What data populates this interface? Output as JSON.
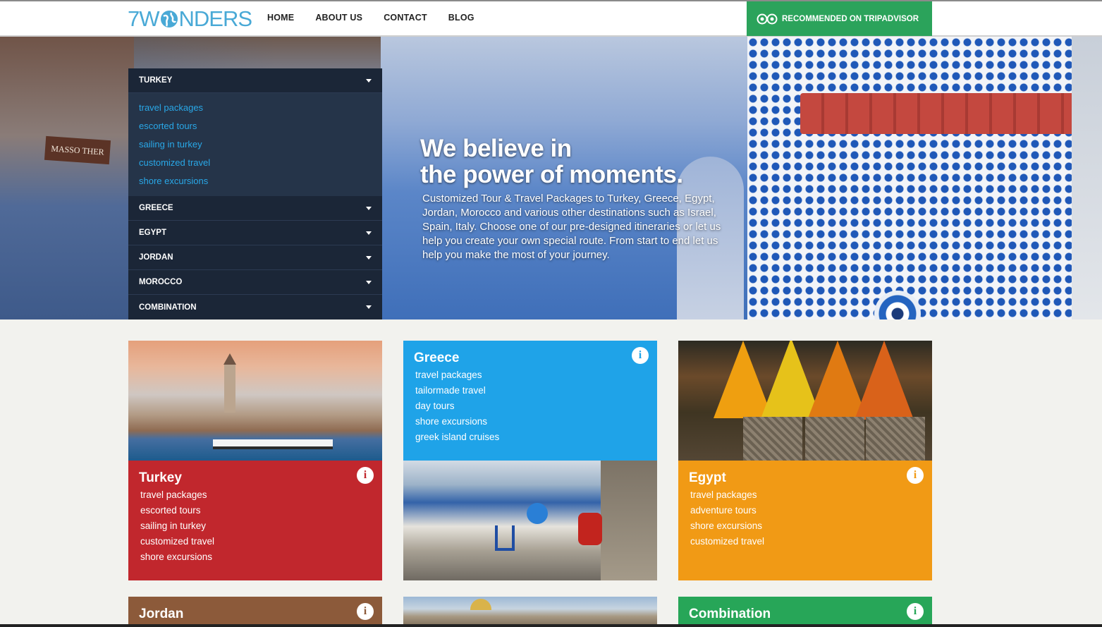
{
  "header": {
    "logo_text": "7WONDERS",
    "nav": [
      "HOME",
      "ABOUT US",
      "CONTACT",
      "BLOG"
    ],
    "tripadvisor_label": "RECOMMENDED ON TRIPADVISOR"
  },
  "hero": {
    "headline_line1": "We believe in",
    "headline_line2": "the power of moments.",
    "description": "Customized Tour & Travel Packages to Turkey, Greece, Egypt, Jordan, Morocco and various other destinations such as Israel, Spain, Italy. Choose one of our pre-designed itineraries or let us help you create your own special route. From start to end let us help you make the most of your journey.",
    "sign_text": "MASSO THER"
  },
  "sidemenu": {
    "items": [
      {
        "label": "TURKEY"
      },
      {
        "label": "GREECE"
      },
      {
        "label": "EGYPT"
      },
      {
        "label": "JORDAN"
      },
      {
        "label": "MOROCCO"
      },
      {
        "label": "COMBINATION"
      }
    ],
    "expanded_links": [
      "travel packages",
      "escorted tours",
      "sailing in turkey",
      "customized travel",
      "shore excursions"
    ]
  },
  "cards": {
    "turkey": {
      "title": "Turkey",
      "color": "#c1272d",
      "links": [
        "travel packages",
        "escorted tours",
        "sailing in turkey",
        "customized travel",
        "shore excursions"
      ]
    },
    "greece": {
      "title": "Greece",
      "color": "#1fa3e8",
      "links": [
        "travel packages",
        "tailormade travel",
        "day tours",
        "shore excursions",
        "greek island cruises"
      ]
    },
    "egypt": {
      "title": "Egypt",
      "color": "#f19a15",
      "links": [
        "travel packages",
        "adventure tours",
        "shore excursions",
        "customized travel"
      ]
    },
    "jordan": {
      "title": "Jordan",
      "color": "#8c5a3a"
    },
    "combination": {
      "title": "Combination",
      "color": "#27a658"
    }
  },
  "icons": {
    "info": "info-icon",
    "caret": "caret-down-icon",
    "tripadvisor": "tripadvisor-owl-icon",
    "globe": "globe-icon"
  }
}
